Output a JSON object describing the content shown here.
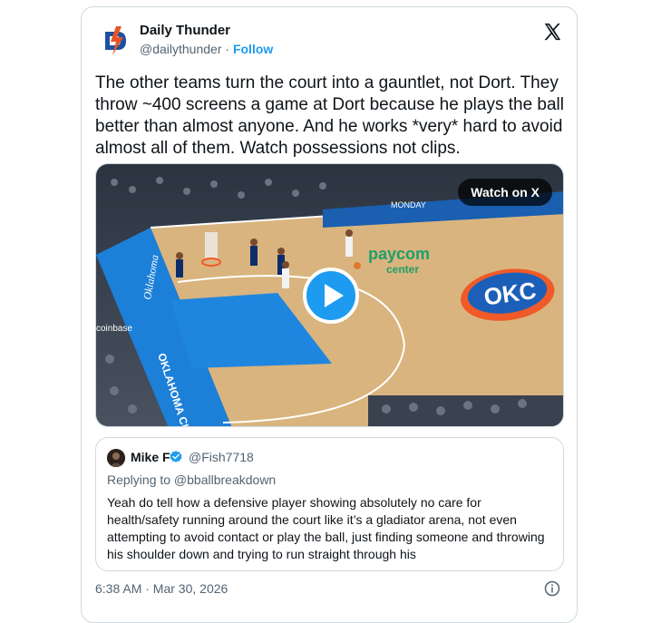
{
  "tweet": {
    "author_name": "Daily Thunder",
    "author_handle": "@dailythunder",
    "separator": "·",
    "follow_label": "Follow",
    "text": "The other teams turn the court into a gauntlet, not Dort. They throw ~400 screens a game at Dort because he plays the ball better than almost anyone. And he works *very* hard to avoid almost all of them. Watch possessions not clips.",
    "media": {
      "watch_label": "Watch on X",
      "court_texts": {
        "sponsor": "paycom",
        "center": "center",
        "logo": "OKC",
        "ad1": "MONDAY",
        "sideline": "OKLAHOMA CITY THUNDER",
        "baseline": "Oklahoma",
        "left_ad": "coinbase"
      }
    },
    "quote": {
      "author_name": "Mike F",
      "author_handle": "@Fish7718",
      "replying_to": "Replying to @bballbreakdown",
      "text": "Yeah do tell how a defensive player showing absolutely no care for health/safety running around the court like it’s a gladiator arena, not even attempting to avoid contact or play the ball, just finding someone and throwing his shoulder down and trying to run straight through his"
    },
    "timestamp": "6:38 AM · Mar 30, 2026"
  },
  "icons": {
    "x_logo": "x-logo-icon",
    "verified": "verified-badge-icon",
    "info": "info-icon",
    "play": "play-icon"
  },
  "colors": {
    "accent": "#1d9bf0",
    "court_blue": "#1a7fd6",
    "floor": "#d8b37c"
  }
}
